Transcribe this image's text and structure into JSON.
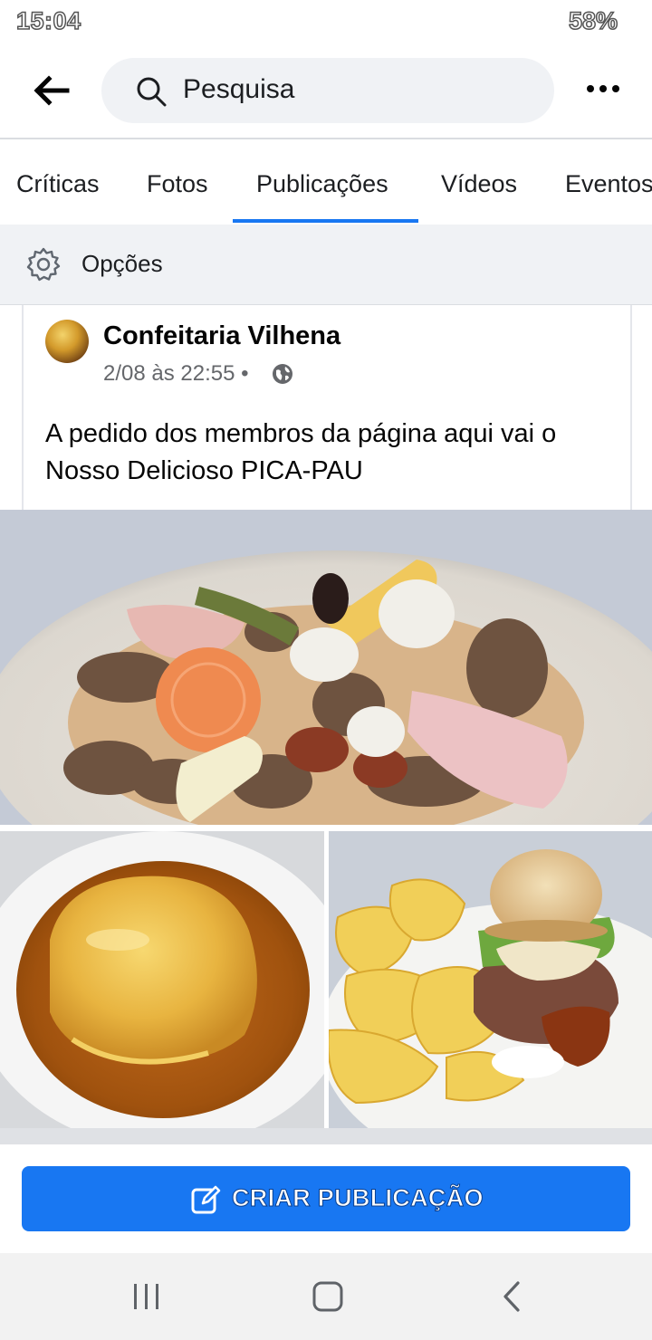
{
  "status_bar": {
    "time": "15:04",
    "battery": "58%"
  },
  "search": {
    "placeholder": "Pesquisa"
  },
  "tabs": [
    {
      "label": "Críticas"
    },
    {
      "label": "Fotos"
    },
    {
      "label": "Publicações",
      "selected": true
    },
    {
      "label": "Vídeos"
    },
    {
      "label": "Eventos"
    }
  ],
  "options": {
    "label": "Opções"
  },
  "post": {
    "author": "Confeitaria Vilhena",
    "timestamp": "2/08 às 22:55",
    "separator": "•",
    "text": "A pedido dos membros da página aqui vai o Nosso Delicioso PICA-PAU",
    "photos": [
      "pica-pau-dish",
      "francesinha-dish",
      "burger-with-chips"
    ]
  },
  "cta": {
    "label": "CRIAR PUBLICAÇÃO",
    "icon": "edit-icon"
  },
  "colors": {
    "accent": "#1877f2",
    "tab_text": "#1c1e21",
    "meta": "#65676b",
    "options_bg": "#f0f2f5"
  }
}
